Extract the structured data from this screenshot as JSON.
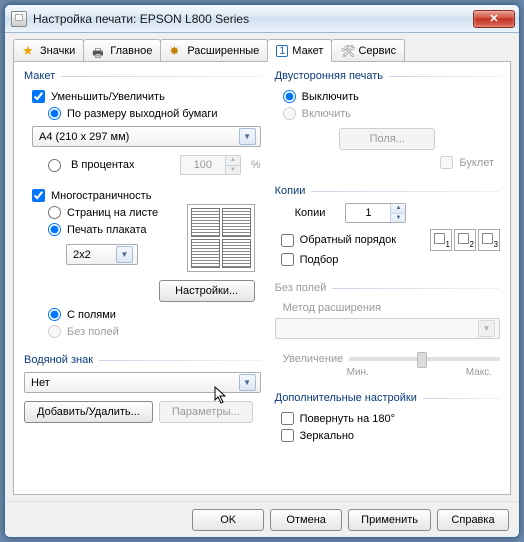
{
  "window": {
    "title": "Настройка печати: EPSON L800 Series"
  },
  "tabs": {
    "badges": "Значки",
    "main": "Главное",
    "advanced": "Расширенные",
    "layout": "Макет",
    "service": "Сервис"
  },
  "layout_group": {
    "title": "Макет",
    "reduce_enlarge": "Уменьшить/Увеличить",
    "fit_to_output": "По размеру выходной бумаги",
    "paper_size": "А4 (210 x 297 мм)",
    "percent": "В процентах",
    "percent_value": "100",
    "percent_suffix": "%",
    "multipage": "Многостраничность",
    "pages_per_sheet": "Страниц на листе",
    "poster": "Печать плаката",
    "poster_size": "2x2",
    "settings_btn": "Настройки...",
    "with_borders": "С полями",
    "borderless": "Без полей"
  },
  "watermark": {
    "title": "Водяной знак",
    "value": "Нет",
    "add_remove": "Добавить/Удалить...",
    "params": "Параметры..."
  },
  "duplex": {
    "title": "Двусторонняя печать",
    "off": "Выключить",
    "on": "Включить",
    "margins": "Поля...",
    "booklet": "Буклет"
  },
  "copies": {
    "title": "Копии",
    "label": "Копии",
    "value": "1",
    "reverse": "Обратный порядок",
    "collate": "Подбор",
    "icon1": "1",
    "icon2": "2",
    "icon3": "3"
  },
  "borderless": {
    "title": "Без полей",
    "method": "Метод расширения",
    "enlarge": "Увеличение",
    "min": "Мин.",
    "max": "Макс."
  },
  "extra": {
    "title": "Дополнительные настройки",
    "rotate": "Повернуть на 180°",
    "mirror": "Зеркально"
  },
  "buttons": {
    "ok": "OK",
    "cancel": "Отмена",
    "apply": "Применить",
    "help": "Справка"
  }
}
